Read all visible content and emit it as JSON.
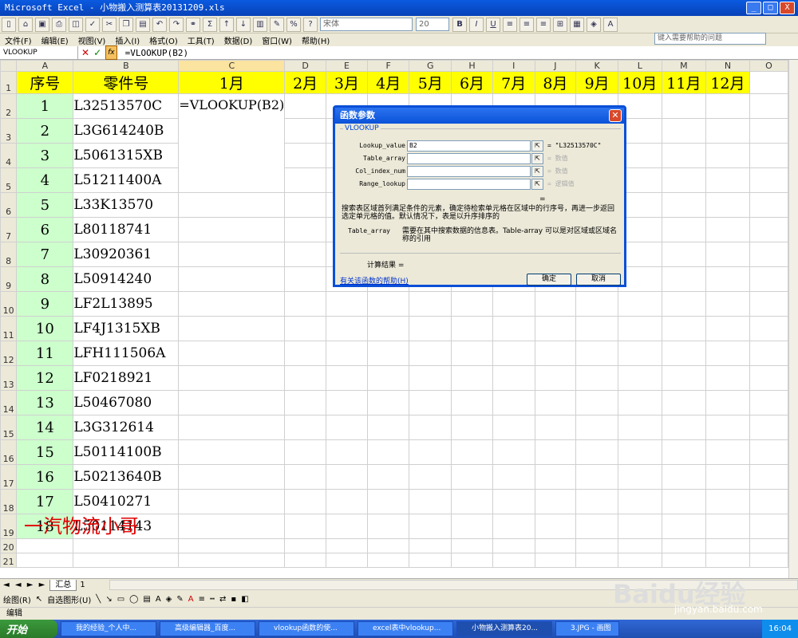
{
  "window": {
    "title": "Microsoft Excel - 小物搬入测算表20131209.xls",
    "controls": [
      "_",
      "□",
      "X"
    ]
  },
  "toolbar": {
    "font_name": "宋体",
    "font_size": "20"
  },
  "menu": {
    "items": [
      "文件(F)",
      "编辑(E)",
      "视图(V)",
      "插入(I)",
      "格式(O)",
      "工具(T)",
      "数据(D)",
      "窗口(W)",
      "帮助(H)"
    ],
    "help_placeholder": "键入需要帮助的问题"
  },
  "formula_bar": {
    "name_box": "VLOOKUP",
    "formula": "=VLOOKUP(B2)"
  },
  "sheet": {
    "columns": [
      "A",
      "B",
      "C",
      "D",
      "E",
      "F",
      "G",
      "H",
      "I",
      "J",
      "K",
      "L",
      "M",
      "N",
      "O"
    ],
    "rows": [
      "1",
      "2",
      "3",
      "4",
      "5",
      "6",
      "7",
      "8",
      "9",
      "10",
      "11",
      "12",
      "13",
      "14",
      "15",
      "16",
      "17",
      "18",
      "19",
      "20",
      "21"
    ],
    "header_a": "序号",
    "header_b": "零件号",
    "months": [
      "1月",
      "2月",
      "3月",
      "4月",
      "5月",
      "6月",
      "7月",
      "8月",
      "9月",
      "10月",
      "11月",
      "12月"
    ],
    "numbers": [
      "1",
      "2",
      "3",
      "4",
      "5",
      "6",
      "7",
      "8",
      "9",
      "10",
      "11",
      "12",
      "13",
      "14",
      "15",
      "16",
      "17",
      "18"
    ],
    "parts": [
      "L32513570C",
      "L3G614240B",
      "L5061315XB",
      "L51211400A",
      "L33K13570",
      "L80118741",
      "L30920361",
      "L50914240",
      "LF2L13895",
      "LF4J1315XB",
      "LFH111506A",
      "LF0218921",
      "L50467080",
      "L3G312614",
      "L50114100B",
      "L50213640B",
      "L50410271",
      "L50114143"
    ],
    "c2_formula": "=VLOOKUP(B2)"
  },
  "tabs": {
    "nav": "◄ ◄ ► ►",
    "active_sheet": "汇总",
    "next": "1"
  },
  "drawing": {
    "draw_label": "绘图(R)",
    "autoshape_label": "自选图形(U)"
  },
  "status": {
    "text": "编辑"
  },
  "taskbar": {
    "start": "开始",
    "tasks": [
      "我的经验_个人中...",
      "高级编辑器_百度...",
      "vlookup函数的使...",
      "excel表中vlookup...",
      "小物搬入测算表20...",
      "3.JPG - 画图"
    ],
    "clock": "16:04"
  },
  "dialog": {
    "title": "函数参数",
    "group": "VLOOKUP",
    "args": [
      {
        "label": "Lookup_value",
        "value": "B2",
        "result": "= \"L32513570C\""
      },
      {
        "label": "Table_array",
        "value": "",
        "result": "= 数值"
      },
      {
        "label": "Col_index_num",
        "value": "",
        "result": "= 数值"
      },
      {
        "label": "Range_lookup",
        "value": "",
        "result": "= 逻辑值"
      }
    ],
    "equals": "=",
    "description": "搜索表区域首列满足条件的元素，确定待检索单元格在区域中的行序号，再进一步返回选定单元格的值。默认情况下，表是以升序排序的",
    "arg_name": "Table_array",
    "arg_description": "需要在其中搜索数据的信息表。Table-array 可以是对区域或区域名称的引用",
    "result_label": "计算结果 =",
    "help_link": "有关该函数的帮助(H)",
    "ok": "确定",
    "cancel": "取消"
  },
  "watermark": {
    "text": "一汽物流小哥"
  },
  "baidu": {
    "logo": "Baidu经验",
    "sub": "jingyan.baidu.com"
  }
}
